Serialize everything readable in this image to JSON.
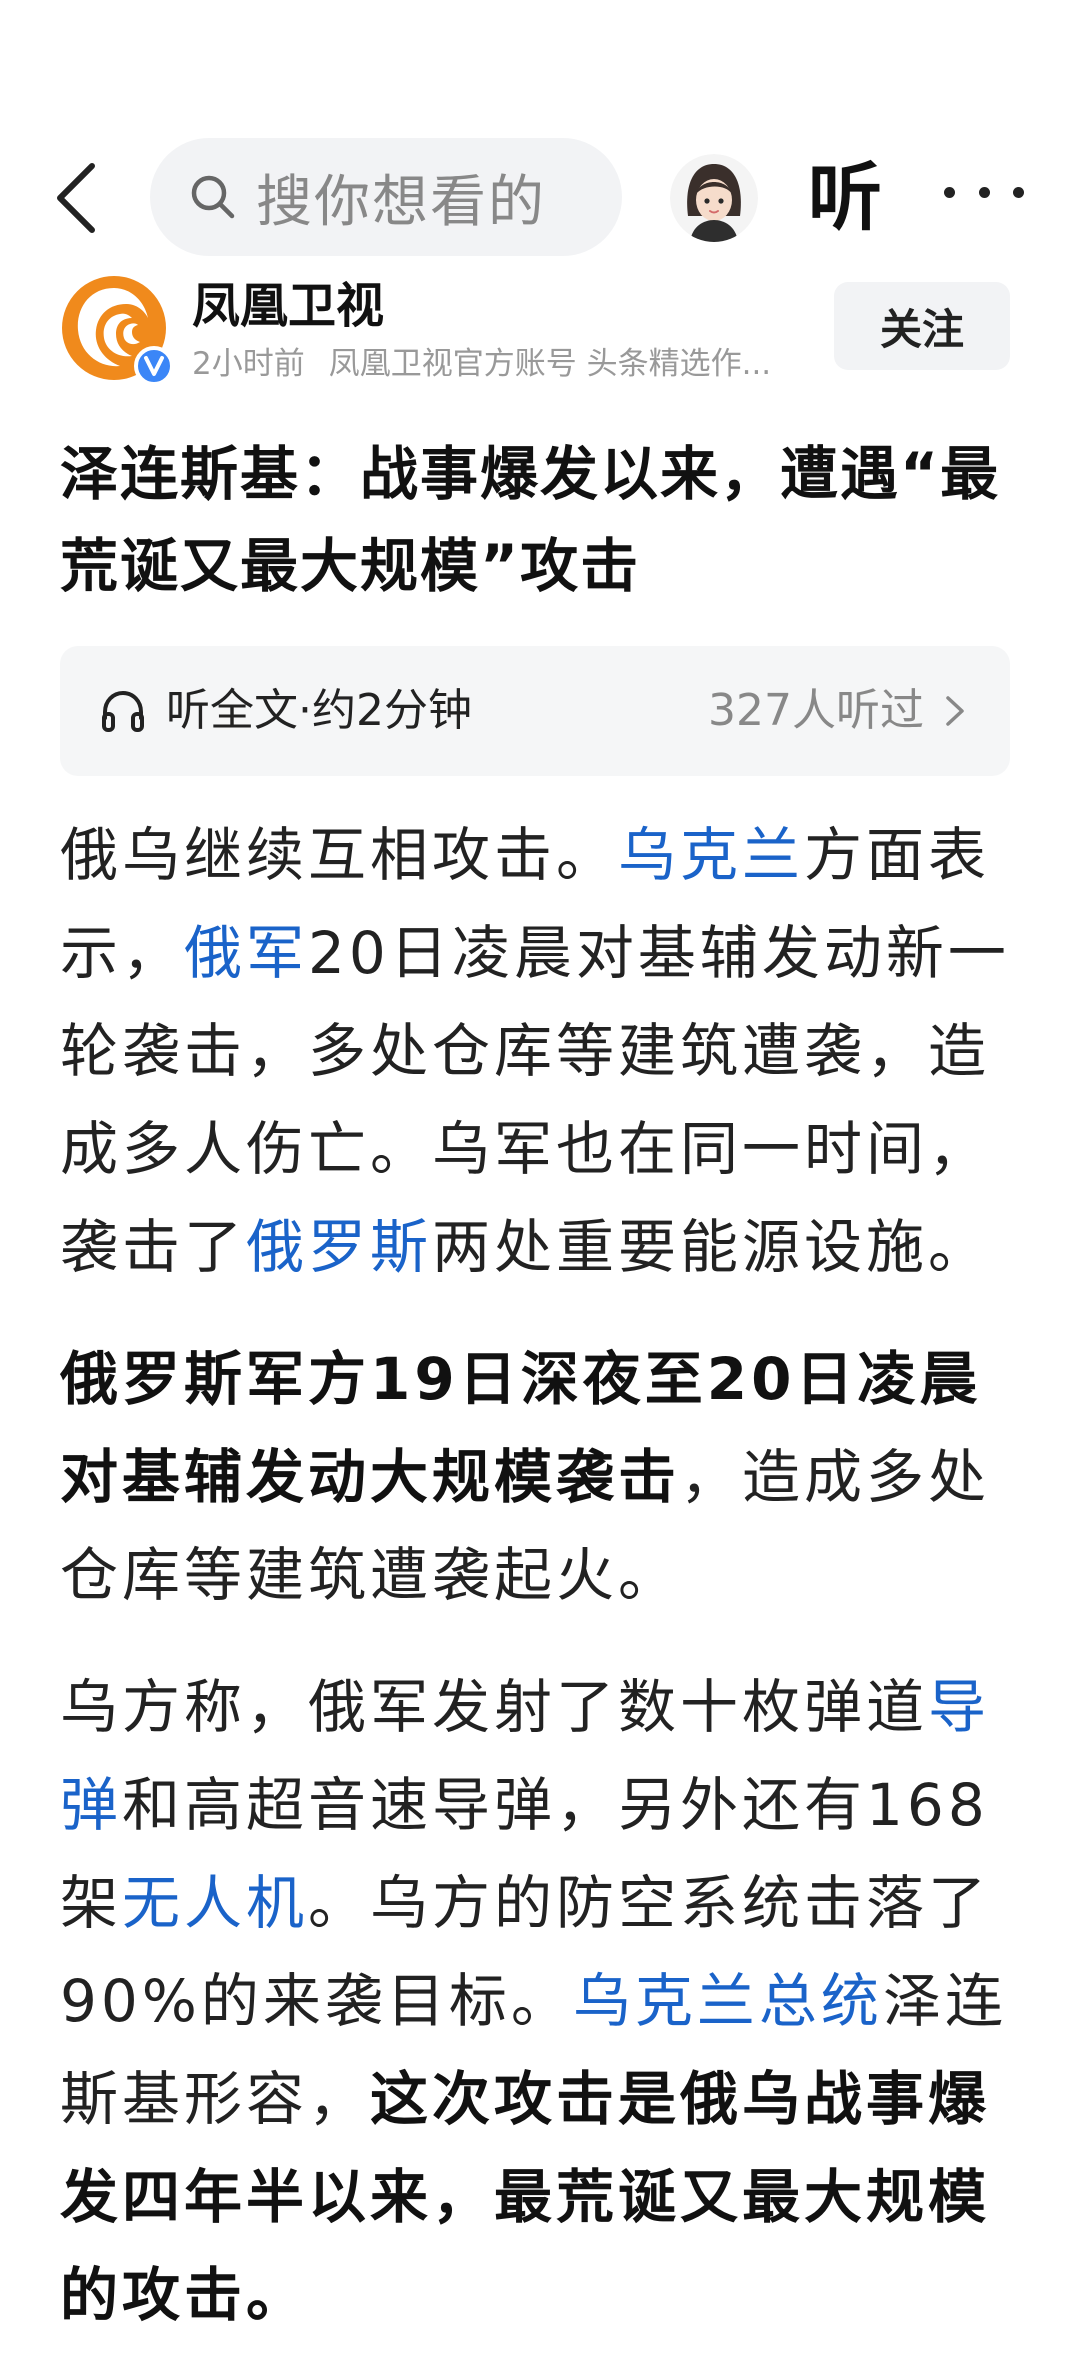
{
  "topbar": {
    "search_placeholder": "搜你想看的",
    "listen_label": "听"
  },
  "author": {
    "name": "凤凰卫视",
    "time": "2小时前",
    "account": "凤凰卫视官方账号",
    "tag": "头条精选作...",
    "follow_label": "关注"
  },
  "article": {
    "title": "泽连斯基：战事爆发以来，遭遇“最荒诞又最大规模”攻击",
    "listen": {
      "label": "听全文·约2分钟",
      "count": "327人听过"
    },
    "p1": {
      "t1": "俄乌继续互相攻击。",
      "link1": "乌克兰",
      "t2": "方面表示，",
      "link2": "俄军",
      "t3": "20日凌晨对基辅发动新一轮袭击，多处仓库等建筑遭袭，造成多人伤亡。乌军也在同一时间，袭击了",
      "link3": "俄罗斯",
      "t4": "两处重要能源设施。"
    },
    "p2": {
      "bold": "俄罗斯军方19日深夜至20日凌晨对基辅发动大规模袭击",
      "rest": "，造成多处仓库等建筑遭袭起火。"
    },
    "p3": {
      "t1": "乌方称，俄军发射了数十枚弹道",
      "link1": "导弹",
      "t2": "和高超音速导弹，另外还有168架",
      "link2": "无人机",
      "t3": "。乌方的防空系统击落了90%的来袭目标。",
      "link3": "乌克兰总统",
      "t4": "泽连斯基形容，",
      "bold": "这次攻击是俄乌战事爆发四年半以来，最荒诞又最大规模的攻击。"
    }
  },
  "colors": {
    "link": "#1a63c9",
    "text": "#222222",
    "muted": "#999999",
    "chip_bg": "#f2f3f5",
    "brand_orange": "#f08a1c",
    "verified_blue": "#3b86f7"
  },
  "icons": [
    "back-arrow-icon",
    "search-icon",
    "avatar",
    "more-icon",
    "phoenix-logo-icon",
    "verified-badge-icon",
    "headphone-icon",
    "chevron-right-icon"
  ]
}
